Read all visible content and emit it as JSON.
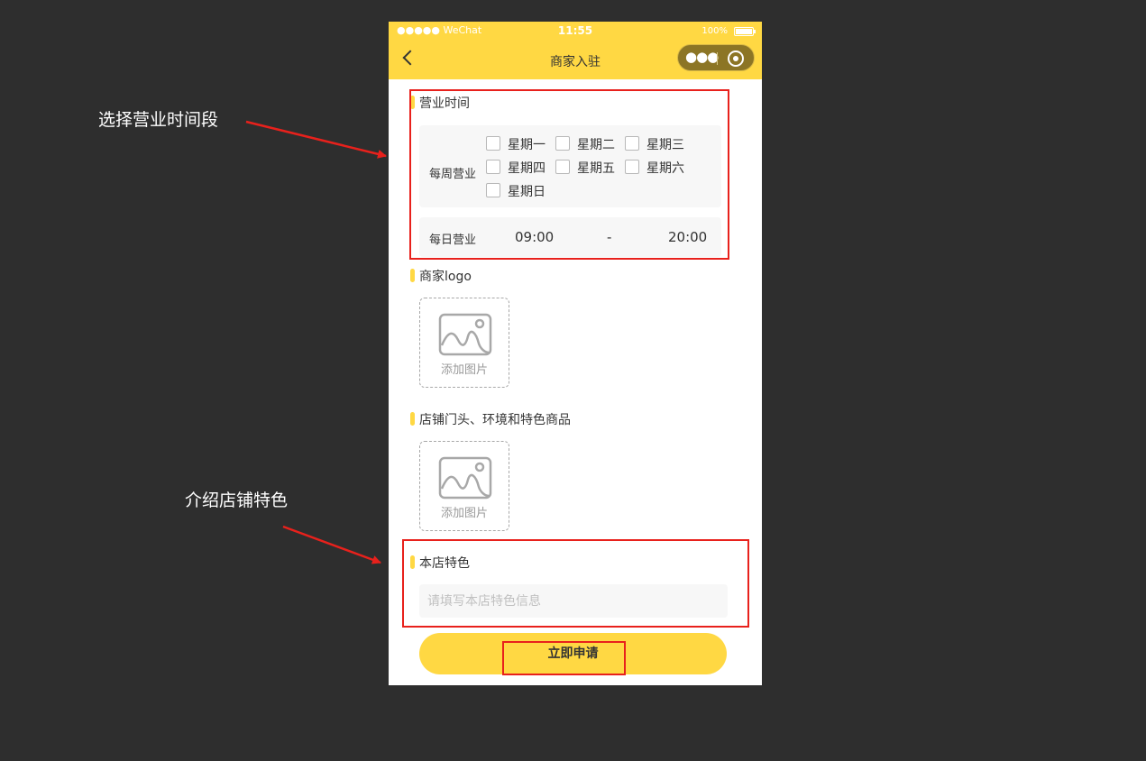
{
  "annotations": {
    "note1": "选择营业时间段",
    "note2": "介绍店铺特色"
  },
  "statusbar": {
    "carrier": "●●●●● WeChat",
    "time": "11:55",
    "battery": "100%"
  },
  "navbar": {
    "title": "商家入驻",
    "menu_dots": "●●●"
  },
  "business_hours": {
    "title": "营业时间",
    "weekly_label": "每周营业",
    "days": [
      "星期一",
      "星期二",
      "星期三",
      "星期四",
      "星期五",
      "星期六",
      "星期日"
    ],
    "daily_label": "每日营业",
    "start_time": "09:00",
    "separator": "-",
    "end_time": "20:00"
  },
  "logo": {
    "title": "商家logo",
    "upload_text": "添加图片"
  },
  "store_photos": {
    "title": "店铺门头、环境和特色商品",
    "upload_text": "添加图片"
  },
  "features": {
    "title": "本店特色",
    "placeholder": "请填写本店特色信息"
  },
  "submit_label": "立即申请",
  "colors": {
    "accent": "#ffd843",
    "highlight": "#e8211c",
    "background": "#2e2e2e"
  }
}
